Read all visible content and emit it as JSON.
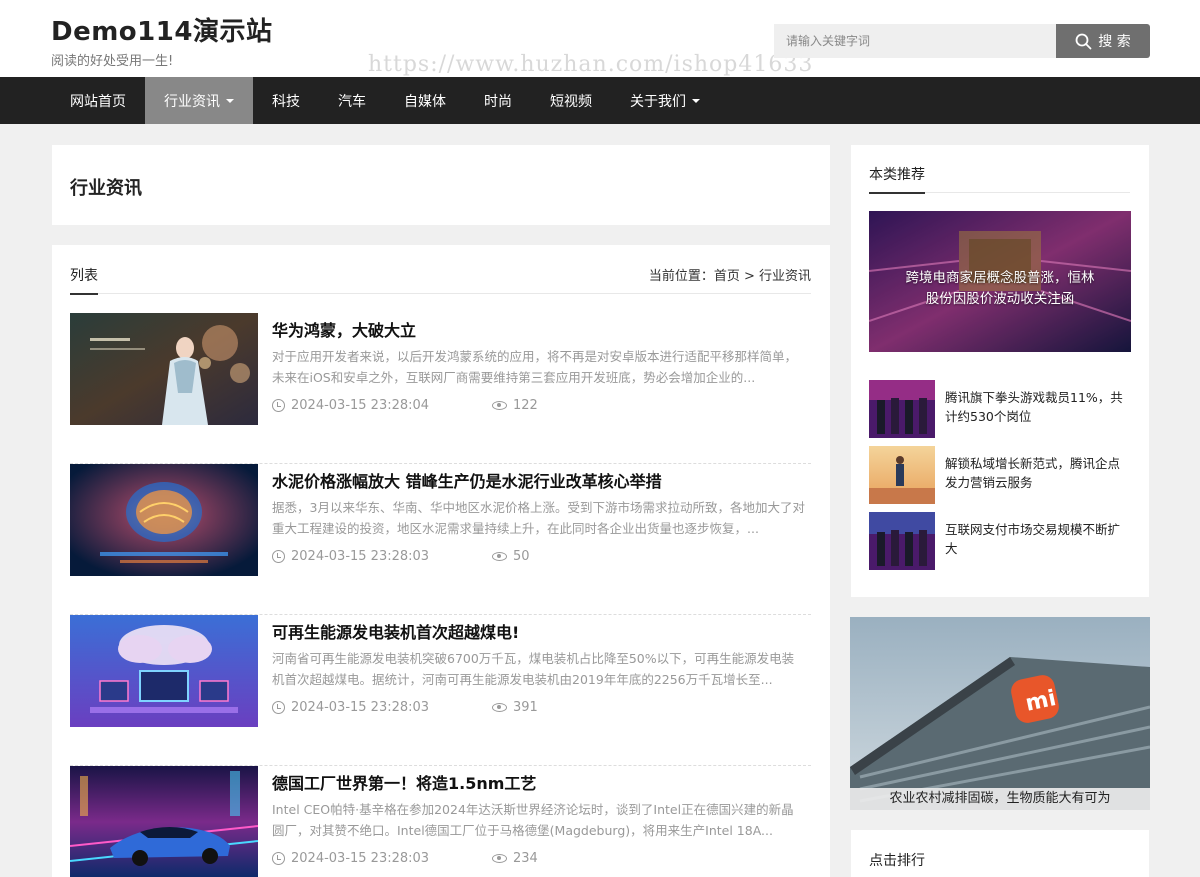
{
  "site": {
    "title": "Demo114演示站",
    "slogan": "阅读的好处受用一生!",
    "watermark": "https://www.huzhan.com/ishop41633"
  },
  "search": {
    "placeholder": "请输入关键字词",
    "button_label": "搜 索"
  },
  "nav": {
    "items": [
      {
        "label": "网站首页"
      },
      {
        "label": "行业资讯"
      },
      {
        "label": "科技"
      },
      {
        "label": "汽车"
      },
      {
        "label": "自媒体"
      },
      {
        "label": "时尚"
      },
      {
        "label": "短视频"
      },
      {
        "label": "关于我们"
      }
    ]
  },
  "category": {
    "title": "行业资讯"
  },
  "list": {
    "tab_label": "列表",
    "breadcrumb": "当前位置：首页 > 行业资讯",
    "articles": [
      {
        "title": "华为鸿蒙，大破大立",
        "desc": "对于应用开发者来说，以后开发鸿蒙系统的应用，将不再是对安卓版本进行适配平移那样简单，未来在iOS和安卓之外，互联网厂商需要维持第三套应用开发班底，势必会增加企业的...",
        "date": "2024-03-15 23:28:04",
        "views": "122"
      },
      {
        "title": "水泥价格涨幅放大 错峰生产仍是水泥行业改革核心举措",
        "desc": "据悉，3月以来华东、华南、华中地区水泥价格上涨。受到下游市场需求拉动所致，各地加大了对重大工程建设的投资，地区水泥需求量持续上升，在此同时各企业出货量也逐步恢复，...",
        "date": "2024-03-15 23:28:03",
        "views": "50"
      },
      {
        "title": "可再生能源发电装机首次超越煤电!",
        "desc": "河南省可再生能源发电装机突破6700万千瓦，煤电装机占比降至50%以下，可再生能源发电装机首次超越煤电。据统计，河南可再生能源发电装机由2019年年底的2256万千瓦增长至...",
        "date": "2024-03-15 23:28:03",
        "views": "391"
      },
      {
        "title": "德国工厂世界第一！将造1.5nm工艺",
        "desc": "Intel CEO帕特·基辛格在参加2024年达沃斯世界经济论坛时，谈到了Intel正在德国兴建的新晶圆厂，对其赞不绝口。Intel德国工厂位于马格德堡(Magdeburg)，将用来生产Intel 18A...",
        "date": "2024-03-15 23:28:03",
        "views": "234"
      }
    ]
  },
  "sidebar": {
    "recommend_title": "本类推荐",
    "feature_caption": "跨境电商家居概念股普涨，恒林股份因股价波动收关注函",
    "items": [
      {
        "title": "腾讯旗下拳头游戏裁员11%，共计约530个岗位"
      },
      {
        "title": "解锁私域增长新范式，腾讯企点发力营销云服务"
      },
      {
        "title": "互联网支付市场交易规模不断扩大"
      }
    ],
    "banner_caption": "农业农村减排固碳，生物质能大有可为",
    "rank_title": "点击排行"
  },
  "colors": {
    "nav_bg": "#222222",
    "nav_active": "#888888",
    "search_button": "#6f6f6f",
    "page_bg": "#f0f0f0"
  }
}
